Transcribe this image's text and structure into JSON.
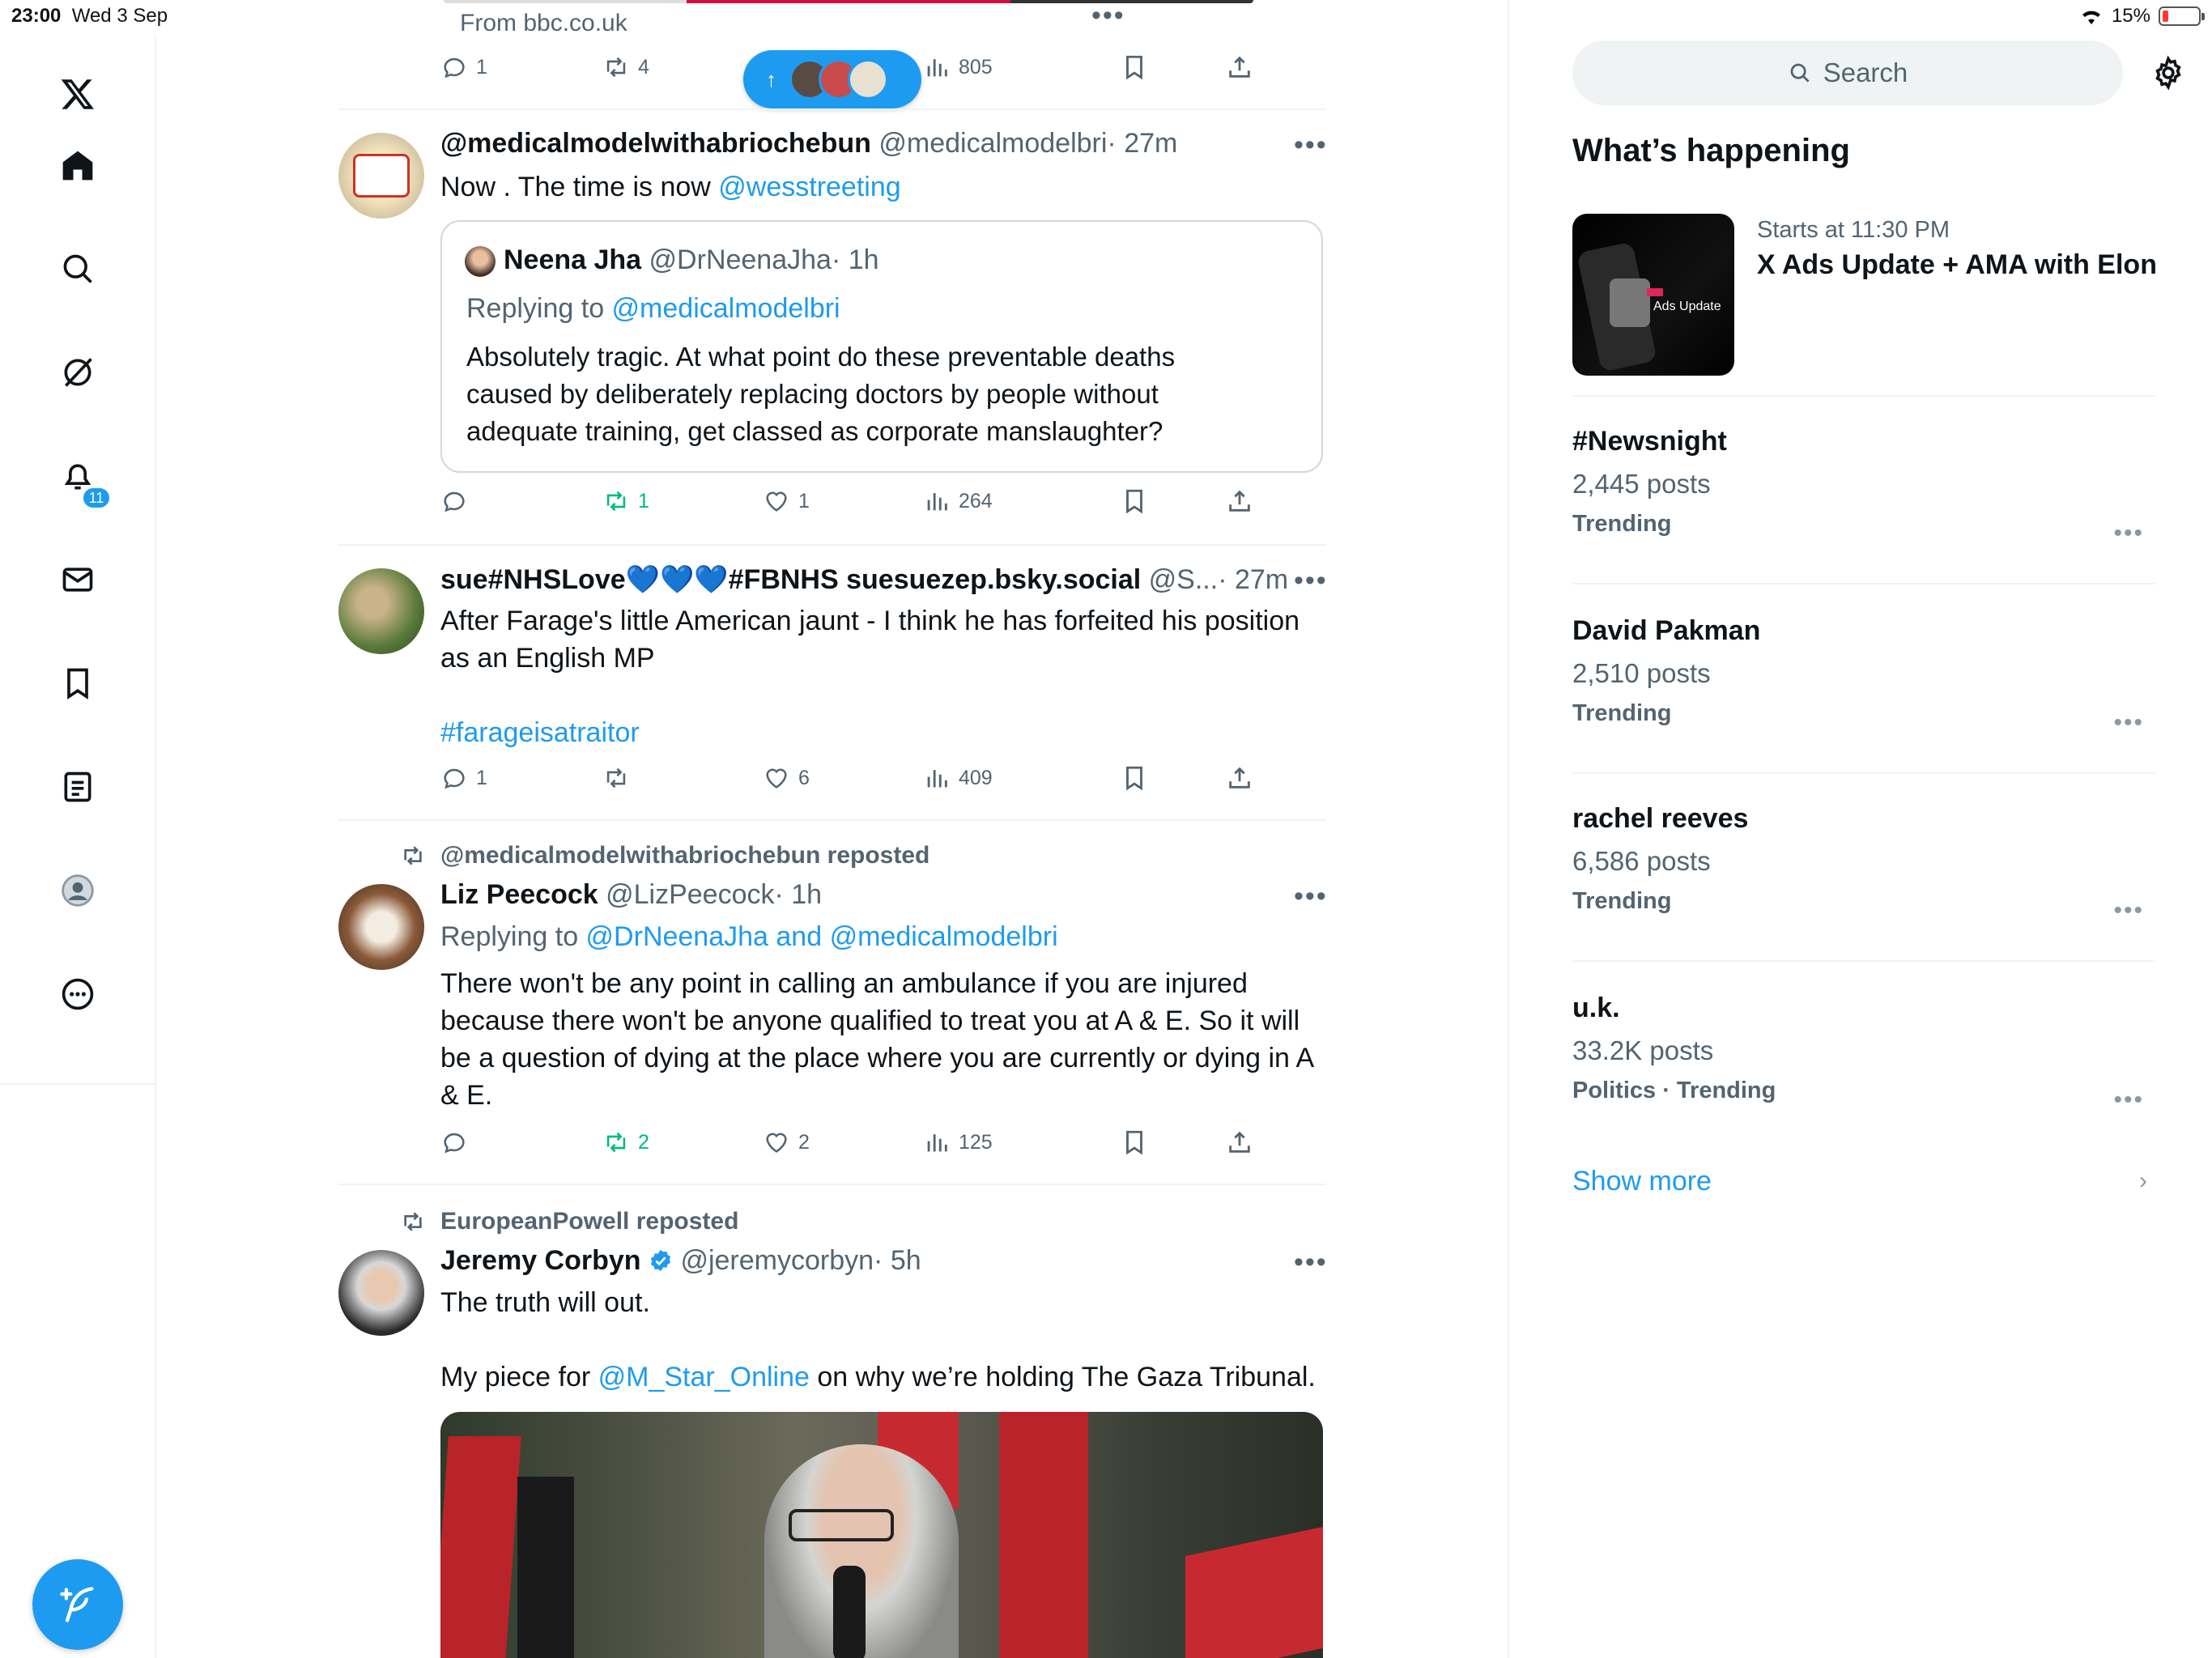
{
  "status_bar": {
    "time": "23:00",
    "date": "Wed 3 Sep",
    "battery": "15%"
  },
  "pill": {
    "arrow": "↑"
  },
  "top_tweet": {
    "source": "From bbc.co.uk",
    "replies": "1",
    "reposts": "4",
    "views": "805"
  },
  "tweets": [
    {
      "name": "@medicalmodelwithabriochebun",
      "handle": "@medicalmodelbri",
      "time": "· 27m",
      "text_prefix": "Now . The time is now ",
      "text_link": "@wesstreeting",
      "quote": {
        "name": "Neena Jha",
        "handle": "@DrNeenaJha",
        "time": "· 1h",
        "replying_prefix": "Replying to ",
        "replying_to": "@medicalmodelbri",
        "text": "Absolutely tragic. At what point do these preventable deaths caused by deliberately replacing doctors by people without adequate training, get classed as corporate manslaughter?"
      },
      "replies": "",
      "reposts": "1",
      "likes": "1",
      "views": "264"
    },
    {
      "name": "sue#NHSLove💙💙💙#FBNHS suesuezep.bsky.social",
      "handle": "@S...",
      "time": "· 27m",
      "text": "After Farage's little American jaunt - I think he has forfeited his position as an English MP",
      "hashtag": "#farageisatraitor",
      "replies": "1",
      "reposts": "",
      "likes": "6",
      "views": "409"
    },
    {
      "reposted_by": "@medicalmodelwithabriochebun reposted",
      "name": "Liz Peecock",
      "handle": "@LizPeecock",
      "time": "· 1h",
      "replying_prefix": "Replying to ",
      "replying_to": "@DrNeenaJha and @medicalmodelbri",
      "text": "There won't be any point in calling an ambulance if you are injured because there won't be anyone qualified to treat you at A & E.  So it will be a question of dying at the place where you are currently or dying in A & E.",
      "replies": "",
      "reposts": "2",
      "likes": "2",
      "views": "125"
    },
    {
      "reposted_by": "EuropeanPowell reposted",
      "name": "Jeremy Corbyn",
      "handle": "@jeremycorbyn",
      "time": "· 5h",
      "text1": "The truth will out.",
      "text2_prefix": "My piece for ",
      "text2_link": "@M_Star_Online",
      "text2_suffix": " on why we’re holding The Gaza Tribunal."
    }
  ],
  "sidebar": {
    "search_placeholder": "Search",
    "section_title": "What’s happening",
    "event": {
      "time": "Starts at 11:30 PM",
      "title": "X Ads Update + AMA with Elon",
      "thumb_label": "Ads Update"
    },
    "trends": [
      {
        "name": "#Newsnight",
        "posts": "2,445 posts",
        "meta": "Trending"
      },
      {
        "name": "David Pakman",
        "posts": "2,510 posts",
        "meta": "Trending"
      },
      {
        "name": "rachel reeves",
        "posts": "6,586 posts",
        "meta": "Trending"
      },
      {
        "name": "u.k.",
        "posts": "33.2K posts",
        "meta": "Politics · Trending"
      }
    ],
    "show_more": "Show more"
  },
  "colors": {
    "accent": "#1d9bf0",
    "repost_green": "#00ba7c",
    "text": "#0f1419",
    "muted": "#536471"
  }
}
